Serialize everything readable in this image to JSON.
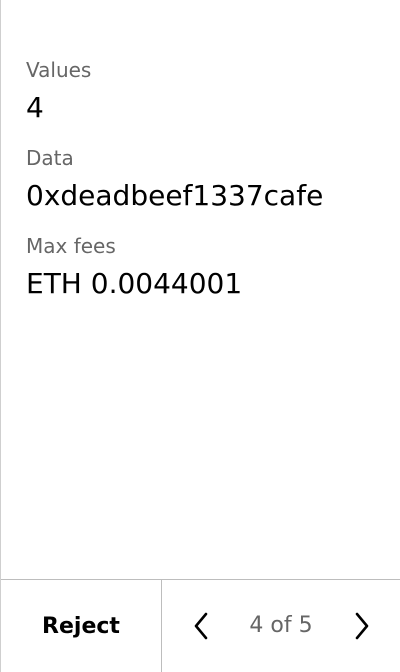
{
  "fields": [
    {
      "label": "Values",
      "value": "4"
    },
    {
      "label": "Data",
      "value": "0xdeadbeef1337cafe"
    },
    {
      "label": "Max fees",
      "value": "ETH 0.0044001"
    }
  ],
  "footer": {
    "reject_label": "Reject",
    "page_indicator": "4 of 5",
    "prev_icon": "chevron-left-icon",
    "next_icon": "chevron-right-icon"
  }
}
